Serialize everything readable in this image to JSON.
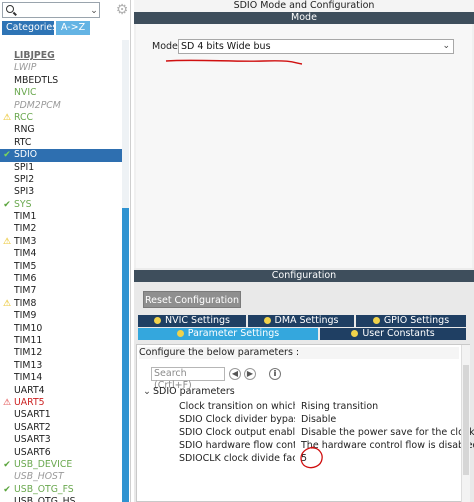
{
  "left_panel": {
    "search": {
      "placeholder": "",
      "value": ""
    },
    "tabs": [
      {
        "label": "Categories"
      },
      {
        "label": "A->Z"
      }
    ],
    "peripherals": [
      {
        "label": "LIBJPEG",
        "state": "bold",
        "mark": ""
      },
      {
        "label": "LWIP",
        "state": "disabled",
        "mark": ""
      },
      {
        "label": "MBEDTLS",
        "state": "normal",
        "mark": ""
      },
      {
        "label": "NVIC",
        "state": "enabled",
        "mark": ""
      },
      {
        "label": "PDM2PCM",
        "state": "disabled",
        "mark": ""
      },
      {
        "label": "RCC",
        "state": "enabled",
        "mark": "warn"
      },
      {
        "label": "RNG",
        "state": "normal",
        "mark": ""
      },
      {
        "label": "RTC",
        "state": "normal",
        "mark": ""
      },
      {
        "label": "SDIO",
        "state": "selected",
        "mark": "ok"
      },
      {
        "label": "SPI1",
        "state": "normal",
        "mark": ""
      },
      {
        "label": "SPI2",
        "state": "normal",
        "mark": ""
      },
      {
        "label": "SPI3",
        "state": "normal",
        "mark": ""
      },
      {
        "label": "SYS",
        "state": "enabled",
        "mark": "ok"
      },
      {
        "label": "TIM1",
        "state": "normal",
        "mark": ""
      },
      {
        "label": "TIM2",
        "state": "normal",
        "mark": ""
      },
      {
        "label": "TIM3",
        "state": "normal",
        "mark": "warn"
      },
      {
        "label": "TIM4",
        "state": "normal",
        "mark": ""
      },
      {
        "label": "TIM5",
        "state": "normal",
        "mark": ""
      },
      {
        "label": "TIM6",
        "state": "normal",
        "mark": ""
      },
      {
        "label": "TIM7",
        "state": "normal",
        "mark": ""
      },
      {
        "label": "TIM8",
        "state": "normal",
        "mark": "warn"
      },
      {
        "label": "TIM9",
        "state": "normal",
        "mark": ""
      },
      {
        "label": "TIM10",
        "state": "normal",
        "mark": ""
      },
      {
        "label": "TIM11",
        "state": "normal",
        "mark": ""
      },
      {
        "label": "TIM12",
        "state": "normal",
        "mark": ""
      },
      {
        "label": "TIM13",
        "state": "normal",
        "mark": ""
      },
      {
        "label": "TIM14",
        "state": "normal",
        "mark": ""
      },
      {
        "label": "UART4",
        "state": "normal",
        "mark": ""
      },
      {
        "label": "UART5",
        "state": "warn-red",
        "mark": "err"
      },
      {
        "label": "USART1",
        "state": "normal",
        "mark": ""
      },
      {
        "label": "USART2",
        "state": "normal",
        "mark": ""
      },
      {
        "label": "USART3",
        "state": "normal",
        "mark": ""
      },
      {
        "label": "USART6",
        "state": "normal",
        "mark": ""
      },
      {
        "label": "USB_DEVICE",
        "state": "enabled",
        "mark": "ok"
      },
      {
        "label": "USB_HOST",
        "state": "disabled",
        "mark": ""
      },
      {
        "label": "USB_OTG_FS",
        "state": "enabled",
        "mark": "ok"
      },
      {
        "label": "USB_OTG_HS",
        "state": "normal",
        "mark": ""
      }
    ]
  },
  "mode_section": {
    "title": "SDIO Mode and Configuration",
    "bar": "Mode",
    "mode_label": "Mode",
    "mode_value": "SD 4 bits Wide bus"
  },
  "config_section": {
    "bar": "Configuration",
    "reset_button": "Reset Configuration",
    "tabs_row1": [
      {
        "label": "NVIC Settings"
      },
      {
        "label": "DMA Settings"
      },
      {
        "label": "GPIO Settings"
      }
    ],
    "tabs_row2": [
      {
        "label": "Parameter Settings",
        "active": true
      },
      {
        "label": "User Constants",
        "active": false
      }
    ],
    "param_header": "Configure the below parameters :",
    "search_placeholder": "Search (Crtl+F)",
    "group": "SDIO parameters",
    "params": [
      {
        "name": "Clock transition on which th...",
        "value": "Rising transition"
      },
      {
        "name": "SDIO Clock divider bypass",
        "value": "Disable"
      },
      {
        "name": "SDIO Clock output enable w...",
        "value": "Disable the power save for the clock"
      },
      {
        "name": "SDIO hardware flow control",
        "value": "The hardware control flow is disabled"
      },
      {
        "name": "SDIOCLK clock divide factor",
        "value": "5"
      }
    ]
  },
  "icons": {
    "search": "search-icon",
    "gear": "gear-icon",
    "dropdown": "chevron-down-icon",
    "ok": "check-icon",
    "warn": "warning-icon",
    "err": "error-icon"
  },
  "colors": {
    "selected_item": "#2e6fb0",
    "enabled_item": "#6aa84f",
    "tab_dark": "#1f3f63",
    "tab_active": "#34a7dd",
    "section_bar": "#3e4e5c",
    "annotation": "#d01010"
  }
}
